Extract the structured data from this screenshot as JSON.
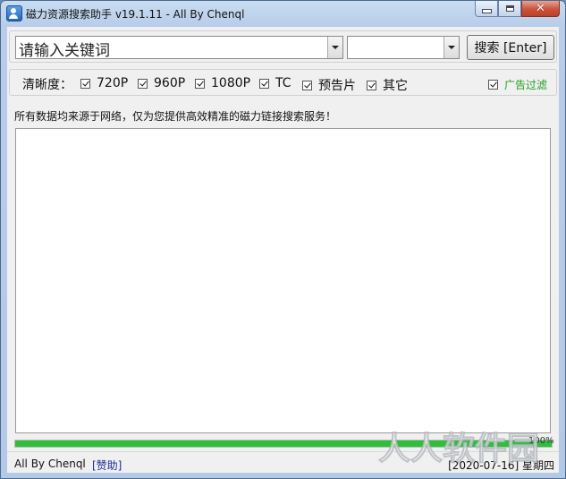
{
  "window": {
    "title": "磁力资源搜索助手 v19.1.11 - All By Chenql"
  },
  "search": {
    "keyword_value": "请输入关键词",
    "category_value": "",
    "button_label": "搜索 [Enter]"
  },
  "filters": {
    "label": "清晰度：",
    "options": [
      {
        "label": "720P",
        "checked": true
      },
      {
        "label": "960P",
        "checked": true
      },
      {
        "label": "1080P",
        "checked": true
      },
      {
        "label": "TC",
        "checked": true
      },
      {
        "label": "预告片",
        "checked": true
      },
      {
        "label": "其它",
        "checked": true
      }
    ],
    "ad_filter": {
      "label": "广告过滤",
      "checked": true,
      "color": "#21a021"
    }
  },
  "info_text": "所有数据均来源于网络，仅为您提供高效精准的磁力链接搜索服务！",
  "results": [],
  "progress": {
    "value": 1.0,
    "label": "100%",
    "color": "#2fbf3a"
  },
  "status": {
    "author": "All By Chenql",
    "donate_label": "[赞助]",
    "date": "[2020-07-16] 星期四"
  },
  "watermark_text": "人人软件园"
}
